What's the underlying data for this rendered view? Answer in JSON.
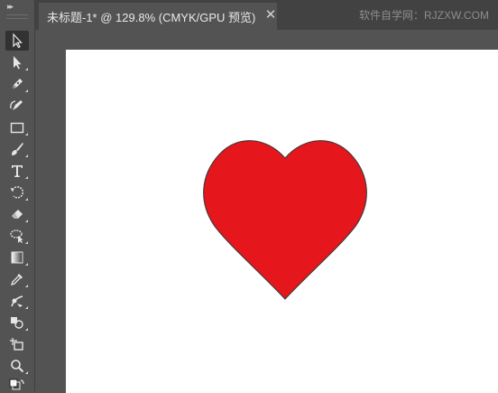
{
  "document_tab": {
    "title": "未标题-1* @ 129.8% (CMYK/GPU 预览)",
    "close_glyph": "✕"
  },
  "watermark": "软件自学网：RJZXW.COM",
  "toolbar": {
    "collapse_glyph": "▸▸",
    "tools": [
      {
        "icon": "selection-tool-icon",
        "active": true
      },
      {
        "icon": "direct-selection-tool-icon"
      },
      {
        "icon": "pen-tool-icon"
      },
      {
        "icon": "curvature-tool-icon"
      },
      {
        "icon": "rectangle-tool-icon"
      },
      {
        "icon": "paintbrush-tool-icon"
      },
      {
        "icon": "type-tool-icon"
      },
      {
        "icon": "rotate-tool-icon"
      },
      {
        "icon": "eraser-tool-icon"
      },
      {
        "icon": "lasso-tool-icon"
      },
      {
        "icon": "gradient-tool-icon"
      },
      {
        "icon": "eyedropper-tool-icon"
      },
      {
        "icon": "blend-tool-icon"
      },
      {
        "icon": "shape-builder-tool-icon"
      },
      {
        "icon": "artboard-tool-icon"
      },
      {
        "icon": "zoom-tool-icon"
      },
      {
        "icon": "fill-stroke-swap-icon"
      }
    ]
  },
  "artwork": {
    "shape": "heart",
    "fill": "#e5161c",
    "stroke": "#3a3a3a"
  },
  "colors": {
    "ui_background": "#535353",
    "tab_bar": "#424242",
    "artboard": "#ffffff"
  }
}
